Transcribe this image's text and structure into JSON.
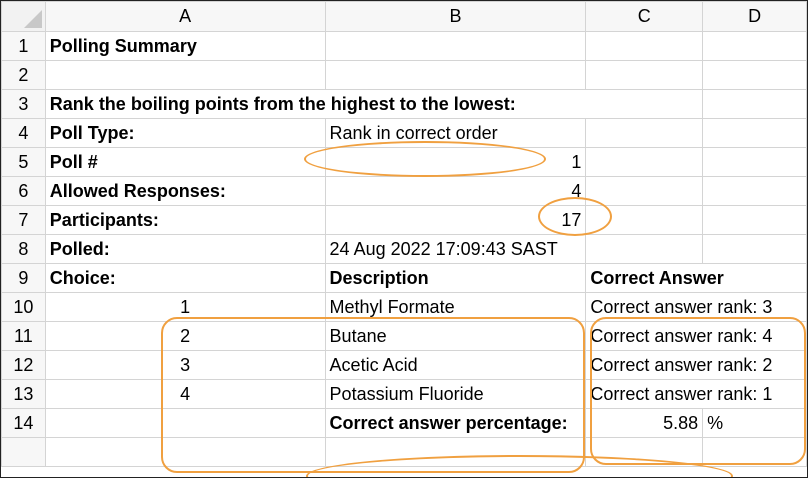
{
  "columns": [
    "A",
    "B",
    "C",
    "D"
  ],
  "rows": [
    {
      "num": "1",
      "a": "Polling Summary",
      "b": "",
      "c": "",
      "d": ""
    },
    {
      "num": "2",
      "a": "",
      "b": "",
      "c": "",
      "d": ""
    },
    {
      "num": "3",
      "a": "Rank the boiling points from the highest to the lowest:",
      "b": "",
      "c": "",
      "d": ""
    },
    {
      "num": "4",
      "a": "Poll Type:",
      "b": "Rank in correct order",
      "c": "",
      "d": ""
    },
    {
      "num": "5",
      "a": "Poll #",
      "b": "1",
      "c": "",
      "d": ""
    },
    {
      "num": "6",
      "a": "Allowed Responses:",
      "b": "4",
      "c": "",
      "d": ""
    },
    {
      "num": "7",
      "a": "Participants:",
      "b": "17",
      "c": "",
      "d": ""
    },
    {
      "num": "8",
      "a": "Polled:",
      "b": "24 Aug 2022 17:09:43 SAST",
      "c": "",
      "d": ""
    },
    {
      "num": "9",
      "a": "Choice:",
      "b": "Description",
      "c": "Correct Answer",
      "d": ""
    },
    {
      "num": "10",
      "a": "1",
      "b": "Methyl Formate",
      "c": "Correct answer rank: 3",
      "d": ""
    },
    {
      "num": "11",
      "a": "2",
      "b": "Butane",
      "c": "Correct answer rank: 4",
      "d": ""
    },
    {
      "num": "12",
      "a": "3",
      "b": "Acetic Acid",
      "c": "Correct answer rank: 2",
      "d": ""
    },
    {
      "num": "13",
      "a": "4",
      "b": "Potassium Fluoride",
      "c": "Correct answer rank: 1",
      "d": ""
    },
    {
      "num": "14",
      "a": "",
      "b": "Correct answer percentage:",
      "c": "5.88",
      "d": "%"
    }
  ],
  "annotation_color": "#f0a040"
}
